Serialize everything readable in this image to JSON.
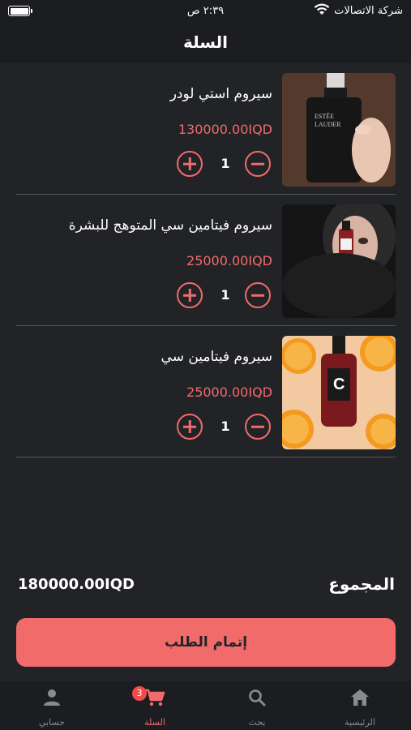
{
  "status_bar": {
    "carrier": "شركة الاتصالات",
    "time": "٢:٣٩ ص"
  },
  "header": {
    "title": "السلة"
  },
  "items": [
    {
      "name": "سيروم استي لودر",
      "price": "130000.00IQD",
      "qty": "1",
      "image": "estee-lauder-serum-photo"
    },
    {
      "name": "سيروم فيتامين سي المتوهج للبشرة",
      "price": "25000.00IQD",
      "qty": "1",
      "image": "glow-vitamin-c-serum-photo"
    },
    {
      "name": "سيروم فيتامين سي",
      "price": "25000.00IQD",
      "qty": "1",
      "image": "vitamin-c-serum-oranges-photo"
    }
  ],
  "summary": {
    "total_label": "المجموع",
    "total_value": "180000.00IQD"
  },
  "checkout": {
    "label": "إتمام الطلب"
  },
  "nav": {
    "home": "الرئيسية",
    "search": "بحث",
    "cart": "السلة",
    "cart_badge": "3",
    "account": "حسابي"
  },
  "colors": {
    "accent": "#f26b6b",
    "background": "#222327",
    "bar": "#1c1d20"
  }
}
